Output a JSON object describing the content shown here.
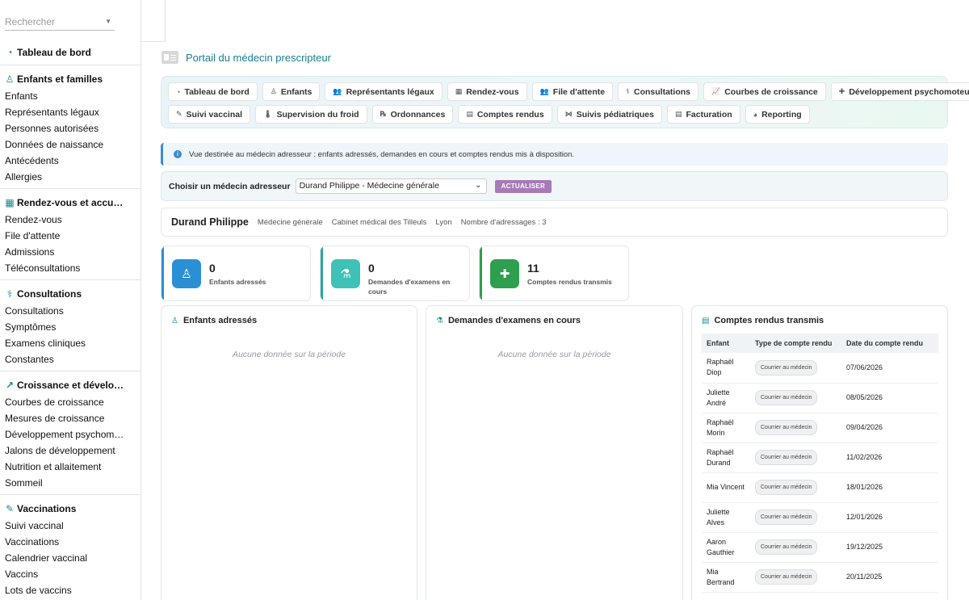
{
  "search": {
    "placeholder": "Rechercher"
  },
  "sidebar": {
    "sections": [
      {
        "title": "Tableau de bord",
        "icon": "gauge-icon",
        "items": []
      },
      {
        "title": "Enfants et familles",
        "icon": "child-icon",
        "items": [
          "Enfants",
          "Représentants légaux",
          "Personnes autorisées",
          "Données de naissance",
          "Antécédents",
          "Allergies"
        ]
      },
      {
        "title": "Rendez-vous et accu…",
        "icon": "calendar-icon",
        "items": [
          "Rendez-vous",
          "File d'attente",
          "Admissions",
          "Téléconsultations"
        ]
      },
      {
        "title": "Consultations",
        "icon": "stethoscope-icon",
        "items": [
          "Consultations",
          "Symptômes",
          "Examens cliniques",
          "Constantes"
        ]
      },
      {
        "title": "Croissance et dévelo…",
        "icon": "chart-line-icon",
        "items": [
          "Courbes de croissance",
          "Mesures de croissance",
          "Développement psychom…",
          "Jalons de développement",
          "Nutrition et allaitement",
          "Sommeil"
        ]
      },
      {
        "title": "Vaccinations",
        "icon": "syringe-icon",
        "items": [
          "Suivi vaccinal",
          "Vaccinations",
          "Calendrier vaccinal",
          "Vaccins",
          "Lots de vaccins"
        ]
      }
    ]
  },
  "page": {
    "title": "Portail du médecin prescripteur",
    "icon": "id-card-icon"
  },
  "tabs": {
    "row1": [
      {
        "label": "Tableau de bord",
        "icon": "gauge-icon",
        "glyph": "◔"
      },
      {
        "label": "Enfants",
        "icon": "child-icon",
        "glyph": "♙"
      },
      {
        "label": "Représentants légaux",
        "icon": "users-icon",
        "glyph": "👥"
      },
      {
        "label": "Rendez-vous",
        "icon": "calendar-icon",
        "glyph": "▦"
      },
      {
        "label": "File d'attente",
        "icon": "people-group-icon",
        "glyph": "👥"
      },
      {
        "label": "Consultations",
        "icon": "stethoscope-icon",
        "glyph": "⚕"
      },
      {
        "label": "Courbes de croissance",
        "icon": "chart-line-icon",
        "glyph": "📈"
      },
      {
        "label": "Développement psychomoteur",
        "icon": "puzzle-icon",
        "glyph": "✚"
      }
    ],
    "row2": [
      {
        "label": "Suivi vaccinal",
        "icon": "syringe-icon",
        "glyph": "✎"
      },
      {
        "label": "Supervision du froid",
        "icon": "thermometer-icon",
        "glyph": "🌡"
      },
      {
        "label": "Ordonnances",
        "icon": "prescription-icon",
        "glyph": "℞"
      },
      {
        "label": "Comptes rendus",
        "icon": "file-medical-icon",
        "glyph": "▤"
      },
      {
        "label": "Suivis pédiatriques",
        "icon": "network-icon",
        "glyph": "⋈"
      },
      {
        "label": "Facturation",
        "icon": "invoice-icon",
        "glyph": "▤"
      },
      {
        "label": "Reporting",
        "icon": "pie-chart-icon",
        "glyph": "◕"
      }
    ]
  },
  "info": {
    "text": "Vue destinée au médecin adresseur : enfants adressés, demandes en cours et comptes rendus mis à disposition.",
    "icon": "info-icon"
  },
  "selector": {
    "label": "Choisir un médecin adresseur",
    "value": "Durand Philippe - Médecine générale",
    "button": "ACTUALISER"
  },
  "doctor": {
    "name": "Durand Philippe",
    "specialty": "Médecine générale",
    "cabinet": "Cabinet médical des Tilleuls",
    "city": "Lyon",
    "referrals": "Nombre d'adressages : 3"
  },
  "stats": [
    {
      "value": "0",
      "label": "Enfants adressés",
      "color": "#2b8fd6",
      "strip": "#2b8fd6",
      "glyph": "♙"
    },
    {
      "value": "0",
      "label": "Demandes d'examens en cours",
      "color": "#3fc1b8",
      "strip": "#2aa79f",
      "glyph": "⚗"
    },
    {
      "value": "11",
      "label": "Comptes rendus transmis",
      "color": "#2e9e4f",
      "strip": "#2e9e4f",
      "glyph": "✚"
    }
  ],
  "panels": {
    "children": {
      "title": "Enfants adressés",
      "empty": "Aucune donnée sur la période"
    },
    "exams": {
      "title": "Demandes d'examens en cours",
      "empty": "Aucune donnée sur la période"
    },
    "reports": {
      "title": "Comptes rendus transmis",
      "columns": [
        "Enfant",
        "Type de compte rendu",
        "Date du compte rendu"
      ],
      "rows": [
        {
          "child": "Raphaël Diop",
          "type": "Courrier au médecin",
          "date": "07/06/2026"
        },
        {
          "child": "Juliette André",
          "type": "Courrier au médecin",
          "date": "08/05/2026"
        },
        {
          "child": "Raphaël Morin",
          "type": "Courrier au médecin",
          "date": "09/04/2026"
        },
        {
          "child": "Raphaël Durand",
          "type": "Courrier au médecin",
          "date": "11/02/2026"
        },
        {
          "child": "Mia Vincent",
          "type": "Courrier au médecin",
          "date": "18/01/2026"
        },
        {
          "child": "Juliette Alves",
          "type": "Courrier au médecin",
          "date": "12/01/2026"
        },
        {
          "child": "Aaron Gauthier",
          "type": "Courrier au médecin",
          "date": "19/12/2025"
        },
        {
          "child": "Mia Bertrand",
          "type": "Courrier au médecin",
          "date": "20/11/2025"
        }
      ]
    }
  }
}
